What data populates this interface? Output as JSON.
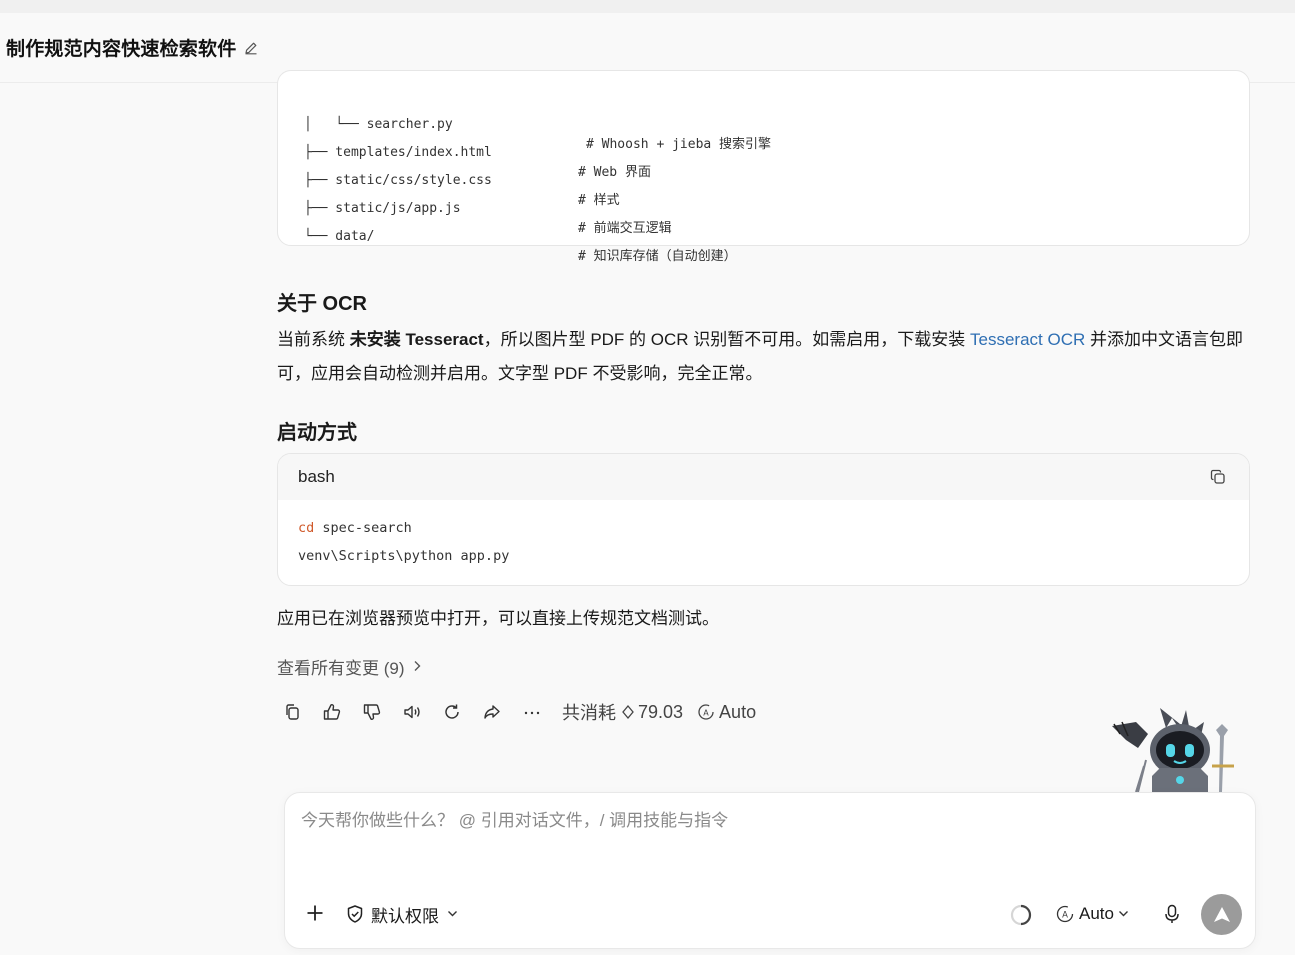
{
  "header": {
    "title": "制作规范内容快速检索软件"
  },
  "tree": [
    {
      "prefix": "│   └── searcher.py",
      "comment": "# Whoosh + jieba 搜索引擎"
    },
    {
      "prefix": "├── templates/index.html",
      "comment": "# Web 界面"
    },
    {
      "prefix": "├── static/css/style.css",
      "comment": "# 样式"
    },
    {
      "prefix": "├── static/js/app.js",
      "comment": "# 前端交互逻辑"
    },
    {
      "prefix": "└── data/",
      "comment": "# 知识库存储（自动创建）"
    }
  ],
  "ocr_section": {
    "heading": "关于 OCR",
    "p1": "当前系统 ",
    "p_bold": "未安装 Tesseract",
    "p2": "，所以图片型 PDF 的 OCR 识别暂不可用。如需启用，下载安装 ",
    "link": "Tesseract OCR",
    "p3": " 并添加中文语言包即可，应用会自动检测并启用。文字型 PDF 不受影响，完全正常。"
  },
  "start_section": {
    "heading": "启动方式",
    "lang": "bash",
    "line1_kw": "cd",
    "line1_rest": " spec-search",
    "line2": "venv\\Scripts\\python app.py"
  },
  "opened_text": "应用已在浏览器预览中打开，可以直接上传规范文档测试。",
  "changes_link": "查看所有变更 (9)",
  "usage": {
    "label": "共消耗",
    "value": "79.03",
    "mode": "Auto"
  },
  "composer": {
    "placeholder": "今天帮你做些什么？ @ 引用对话文件，/ 调用技能与指令",
    "permission": "默认权限",
    "model": "Auto"
  }
}
